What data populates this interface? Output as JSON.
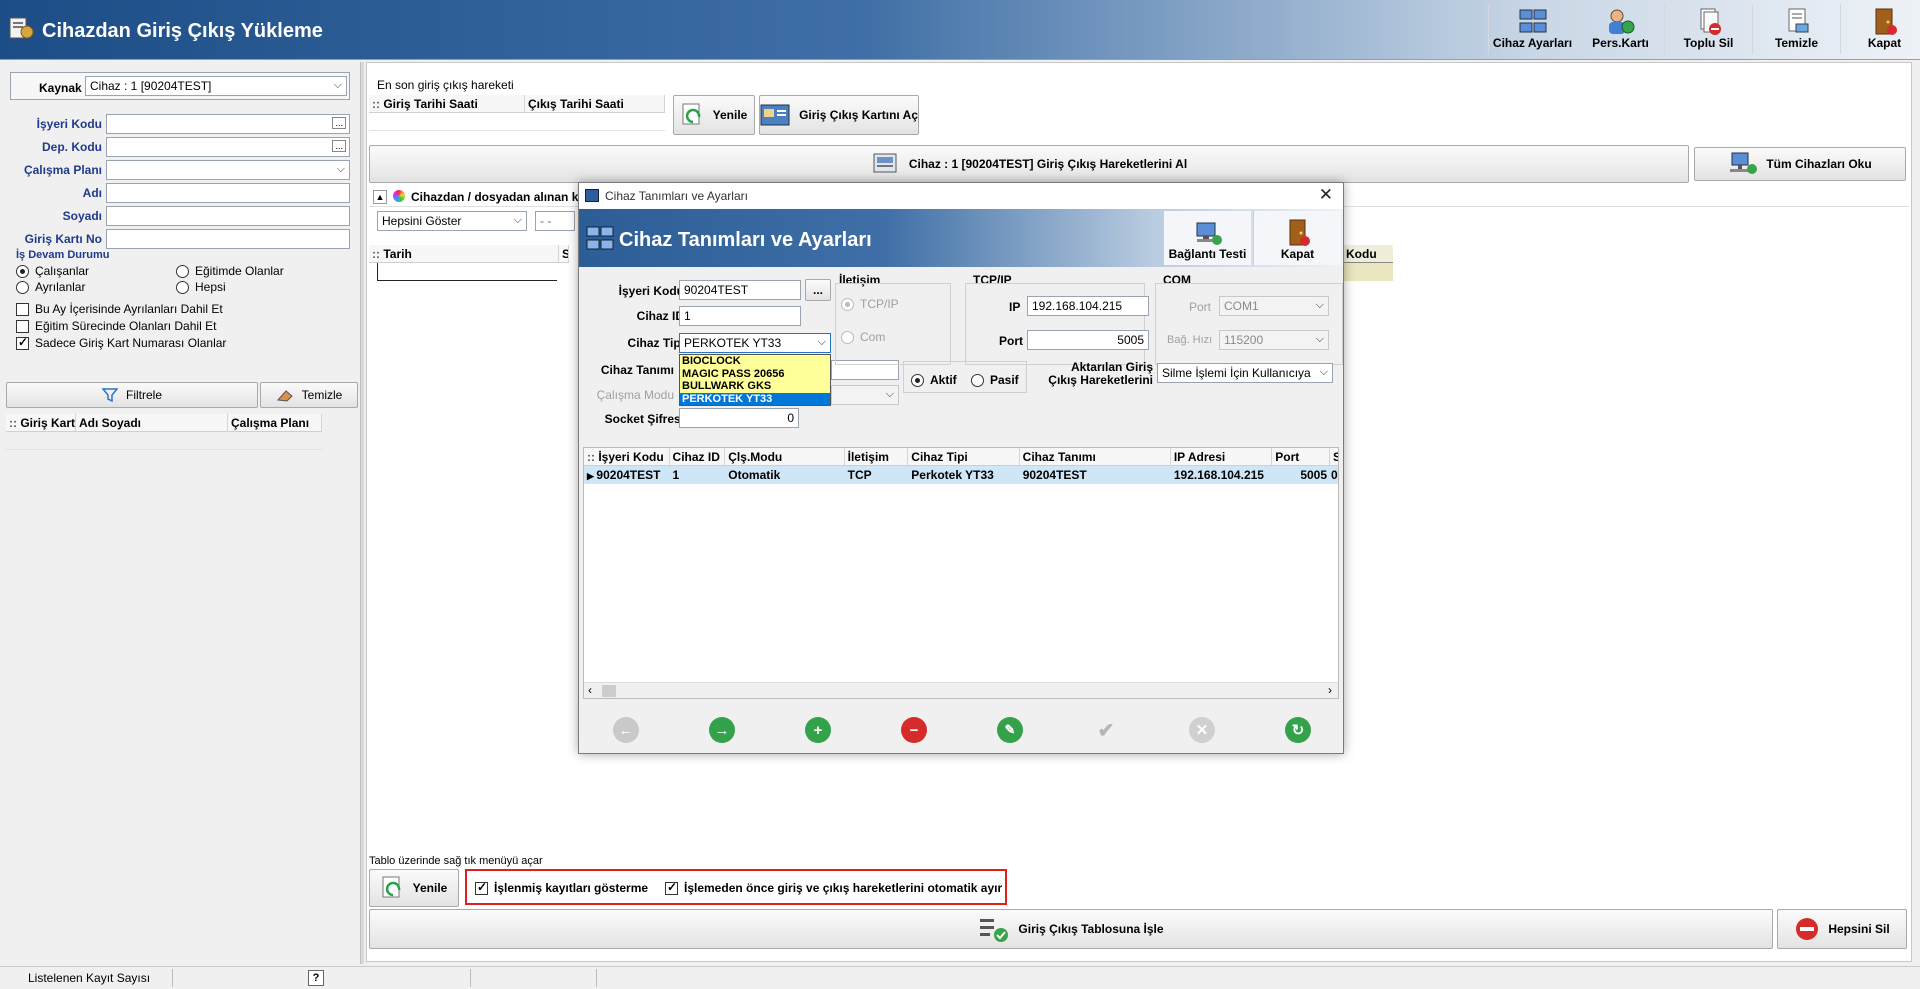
{
  "app": {
    "title": "Cihazdan Giriş Çıkış Yükleme",
    "toolbar": [
      {
        "label": "Cihaz Ayarları",
        "icon": "device-settings-icon"
      },
      {
        "label": "Pers.Kartı",
        "icon": "personnel-card-icon"
      },
      {
        "label": "Toplu Sil",
        "icon": "bulk-delete-icon"
      },
      {
        "label": "Temizle",
        "icon": "clear-icon"
      },
      {
        "label": "Kapat",
        "icon": "exit-door-icon"
      }
    ]
  },
  "left": {
    "kaynak_label": "Kaynak",
    "kaynak_value": "Cihaz : 1 [90204TEST]",
    "fields": [
      "İşyeri Kodu",
      "Dep. Kodu",
      "Çalışma Planı",
      "Adı",
      "Soyadı",
      "Giriş Kartı No"
    ],
    "is_devam_title": "İş Devam Durumu",
    "radios": [
      "Çalışanlar",
      "Eğitimde Olanlar",
      "Ayrılanlar",
      "Hepsi"
    ],
    "checks": [
      "Bu Ay İçerisinde Ayrılanları Dahil Et",
      "Eğitim Sürecinde Olanları Dahil Et",
      "Sadece Giriş Kart Numarası Olanlar"
    ],
    "filtrele": "Filtrele",
    "temizle": "Temizle",
    "grid_cols": [
      "Giriş Kart",
      "Adı Soyadı",
      "Çalışma Planı"
    ]
  },
  "main": {
    "last_title": "En son giriş çıkış hareketi",
    "last_cols": [
      "Giriş Tarihi Saati",
      "Çıkış Tarihi Saati"
    ],
    "yenile": "Yenile",
    "card_open": "Giriş Çıkış Kartını Aç",
    "get_moves": "Cihaz : 1 [90204TEST] Giriş Çıkış Hareketlerini Al",
    "read_all": "Tüm Cihazları Oku",
    "section_title": "Cihazdan / dosyadan alınan k",
    "filter_value": "Hepsini Göster",
    "date_stub": "- -",
    "grid_cols": [
      "Tarih",
      "Sa"
    ],
    "kodu_col": "Kodu",
    "hint": "Tablo üzerinde sağ tık menüyü açar",
    "yenile2": "Yenile",
    "chk_processed": "İşlenmiş kayıtları gösterme",
    "chk_split": "İşlemeden önce giriş ve çıkış hareketlerini  otomatik ayır",
    "process": "Giriş Çıkış Tablosuna İşle",
    "delete_all": "Hepsini Sil"
  },
  "status": {
    "count_label": "Listelenen Kayıt Sayısı",
    "help": "?"
  },
  "dialog": {
    "window_title": "Cihaz Tanımları ve Ayarları",
    "header_title": "Cihaz Tanımları ve Ayarları",
    "test_btn": "Bağlantı Testi",
    "close_btn": "Kapat",
    "isyeri_label": "İşyeri Kodu",
    "isyeri_value": "90204TEST",
    "browse": "...",
    "cihaz_id_label": "Cihaz ID",
    "cihaz_id_value": "1",
    "cihaz_tipi_label": "Cihaz Tipi",
    "cihaz_tipi_value": "PERKOTEK YT33",
    "cihaz_tipi_options": [
      "BIOCLOCK",
      "MAGIC PASS 20656",
      "BULLWARK GKS",
      "PERKOTEK YT33"
    ],
    "cihaz_tanimi_label": "Cihaz Tanımı",
    "calisma_modu_label": "Çalışma Modu",
    "socket_label": "Socket Şifresi",
    "socket_value": "0",
    "iletisim_title": "İletişim",
    "iletisim_options": [
      "TCP/IP",
      "Com"
    ],
    "tcpip_title": "TCP/IP",
    "ip_label": "IP",
    "ip_value": "192.168.104.215",
    "port_label": "Port",
    "port_value": "5005",
    "com_title": "COM",
    "com_port_label": "Port",
    "com_port_value": "COM1",
    "baud_label": "Bağ. Hızı",
    "baud_value": "115200",
    "aktif": "Aktif",
    "pasif": "Pasif",
    "transfer_label_1": "Aktarılan Giriş",
    "transfer_label_2": "Çıkış Hareketlerini",
    "transfer_value": "Silme İşlemi İçin Kullanıcıya",
    "grid_cols": [
      "İşyeri Kodu",
      "Cihaz ID",
      "Çlş.Modu",
      "İletişim",
      "Cihaz Tipi",
      "Cihaz Tanımı",
      "IP Adresi",
      "Port",
      "S"
    ],
    "grid_row": [
      "90204TEST",
      "1",
      "Otomatik",
      "TCP",
      "Perkotek YT33",
      "90204TEST",
      "192.168.104.215",
      "5005",
      "0"
    ]
  },
  "colors": {
    "header_blue": "#2a5a92",
    "selection_blue": "#0078d7",
    "dropdown_yellow": "#ffff99",
    "highlight_red": "#e0201c"
  }
}
